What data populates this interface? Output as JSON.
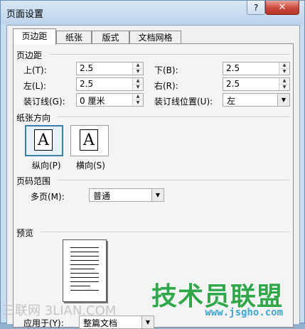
{
  "window": {
    "title": "页面设置",
    "help_label": "?",
    "close_label": "✕"
  },
  "tabs": [
    {
      "label": "页边距",
      "active": true
    },
    {
      "label": "纸张",
      "active": false
    },
    {
      "label": "版式",
      "active": false
    },
    {
      "label": "文档网格",
      "active": false
    }
  ],
  "margins": {
    "section_title": "页边距",
    "top_label": "上(T):",
    "top_value": "2.5",
    "bottom_label": "下(B):",
    "bottom_value": "2.5",
    "left_label": "左(L):",
    "left_value": "2.5",
    "right_label": "右(R):",
    "right_value": "2.5",
    "gutter_label": "装订线(G):",
    "gutter_value": "0 厘米",
    "gutter_pos_label": "装订线位置(U):",
    "gutter_pos_value": "左"
  },
  "orientation": {
    "section_title": "纸张方向",
    "portrait_label": "纵向(P)",
    "landscape_label": "横向(S)",
    "glyph": "A",
    "selected": "portrait"
  },
  "pages": {
    "section_title": "页码范围",
    "multiple_label": "多页(M):",
    "multiple_value": "普通"
  },
  "preview": {
    "section_title": "预览",
    "apply_label": "应用于(Y):",
    "apply_value": "整篇文档"
  },
  "watermark": {
    "site_name": "技术员联盟",
    "site_url": "www.jsgho.com",
    "left_mark": "三联网 3LIAN.COM"
  },
  "icons": {
    "spin_up": "▲",
    "spin_down": "▼",
    "dropdown": "▼"
  }
}
